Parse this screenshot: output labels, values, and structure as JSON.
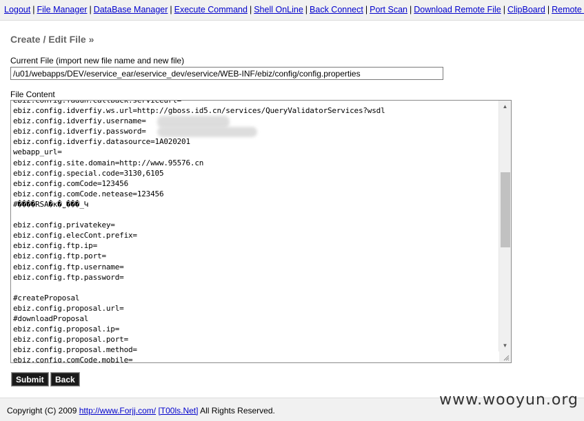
{
  "nav": {
    "links": [
      "Logout",
      "File Manager",
      "DataBase Manager",
      "Execute Command",
      "Shell OnLine",
      "Back Connect",
      "Port Scan",
      "Download Remote File",
      "ClipBoard",
      "Remote Co"
    ],
    "separator": "|"
  },
  "page": {
    "title": "Create / Edit File »"
  },
  "form": {
    "current_file_label": "Current File (import new file name and new file)",
    "current_file_value": "/u01/webapps/DEV/eservice_ear/eservice_dev/eservice/WEB-INF/ebiz/config/config.properties",
    "file_content_label": "File Content",
    "code_lines": [
      "ebiz.config.fadun.callback.serviceurl=",
      "ebiz.config.idverfiy.ws.url=http://gboss.id5.cn/services/QueryValidatorServices?wsdl",
      "ebiz.config.idverfiy.username=",
      "ebiz.config.idverfiy.password=",
      "ebiz.config.idverfiy.datasource=1A020201",
      "webapp_url=",
      "ebiz.config.site.domain=http://www.95576.cn",
      "ebiz.config.special.code=3130,6105",
      "ebiz.config.comCode=123456",
      "ebiz.config.comCode.netease=123456",
      "#����RSA�ĸ�˽���_Կ",
      "",
      "ebiz.config.privatekey=",
      "ebiz.config.elecCont.prefix=",
      "ebiz.config.ftp.ip=",
      "ebiz.config.ftp.port=",
      "ebiz.config.ftp.username=",
      "ebiz.config.ftp.password=",
      "",
      "#createProposal",
      "ebiz.config.proposal.url=",
      "#downloadProposal",
      "ebiz.config.proposal.ip=",
      "ebiz.config.proposal.port=",
      "ebiz.config.proposal.method=",
      "ebiz.config.comCode.mobile="
    ],
    "submit_label": "Submit",
    "back_label": "Back"
  },
  "footer": {
    "copyright": "Copyright (C) 2009",
    "link1": "http://www.Forjj.com/",
    "link2": "[T00ls.Net]",
    "rights": "All Rights Reserved."
  },
  "watermark": "www.wooyun.org",
  "icons": {
    "scroll_up": "scroll-up-arrow-icon",
    "scroll_down": "scroll-down-arrow-icon",
    "resize": "resize-grip-icon"
  },
  "colors": {
    "link": "#0000cc",
    "bar_background": "#f1f1f1",
    "title": "#666666",
    "button_background": "#1a1a1a"
  }
}
